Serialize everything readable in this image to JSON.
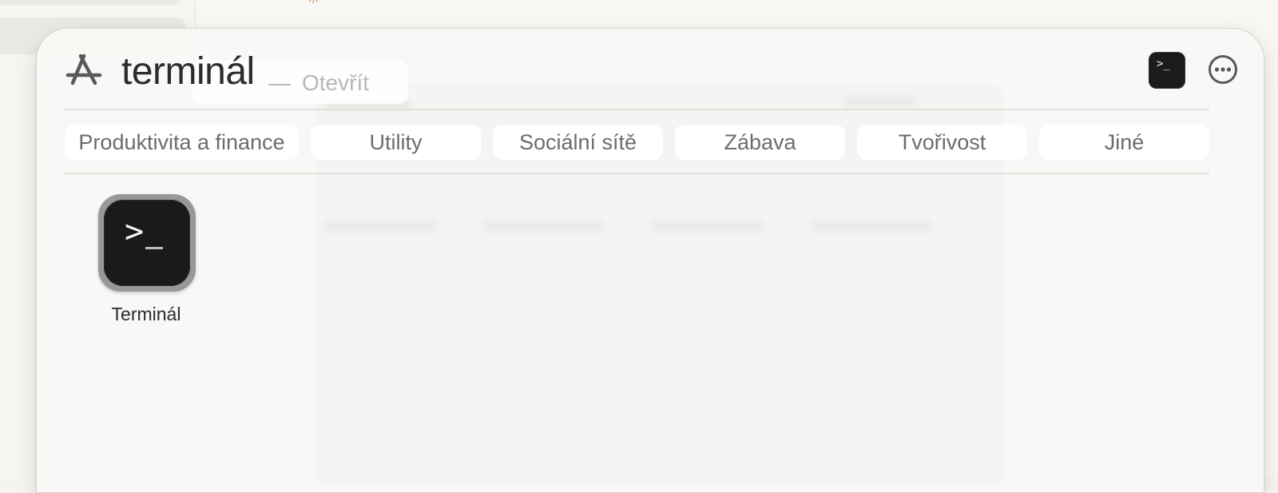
{
  "launcher": {
    "query": "terminál",
    "hint_dash": "—",
    "hint_action": "Otevřít",
    "store_icon": "app-store-icon",
    "top_result_icon": "terminal-icon",
    "more_icon": "ellipsis-circle-icon",
    "terminal_glyph": ">_"
  },
  "categories": [
    {
      "label": "Produktivita a finance"
    },
    {
      "label": "Utility"
    },
    {
      "label": "Sociální sítě"
    },
    {
      "label": "Zábava"
    },
    {
      "label": "Tvořivost"
    },
    {
      "label": "Jiné"
    }
  ],
  "results": [
    {
      "name": "Terminál",
      "icon": "terminal-icon",
      "glyph": ">"
    }
  ],
  "colors": {
    "accent_spark": "#d9774f",
    "panel_bg": "#f9f8f6",
    "terminal_bg": "#1a1a1a"
  }
}
